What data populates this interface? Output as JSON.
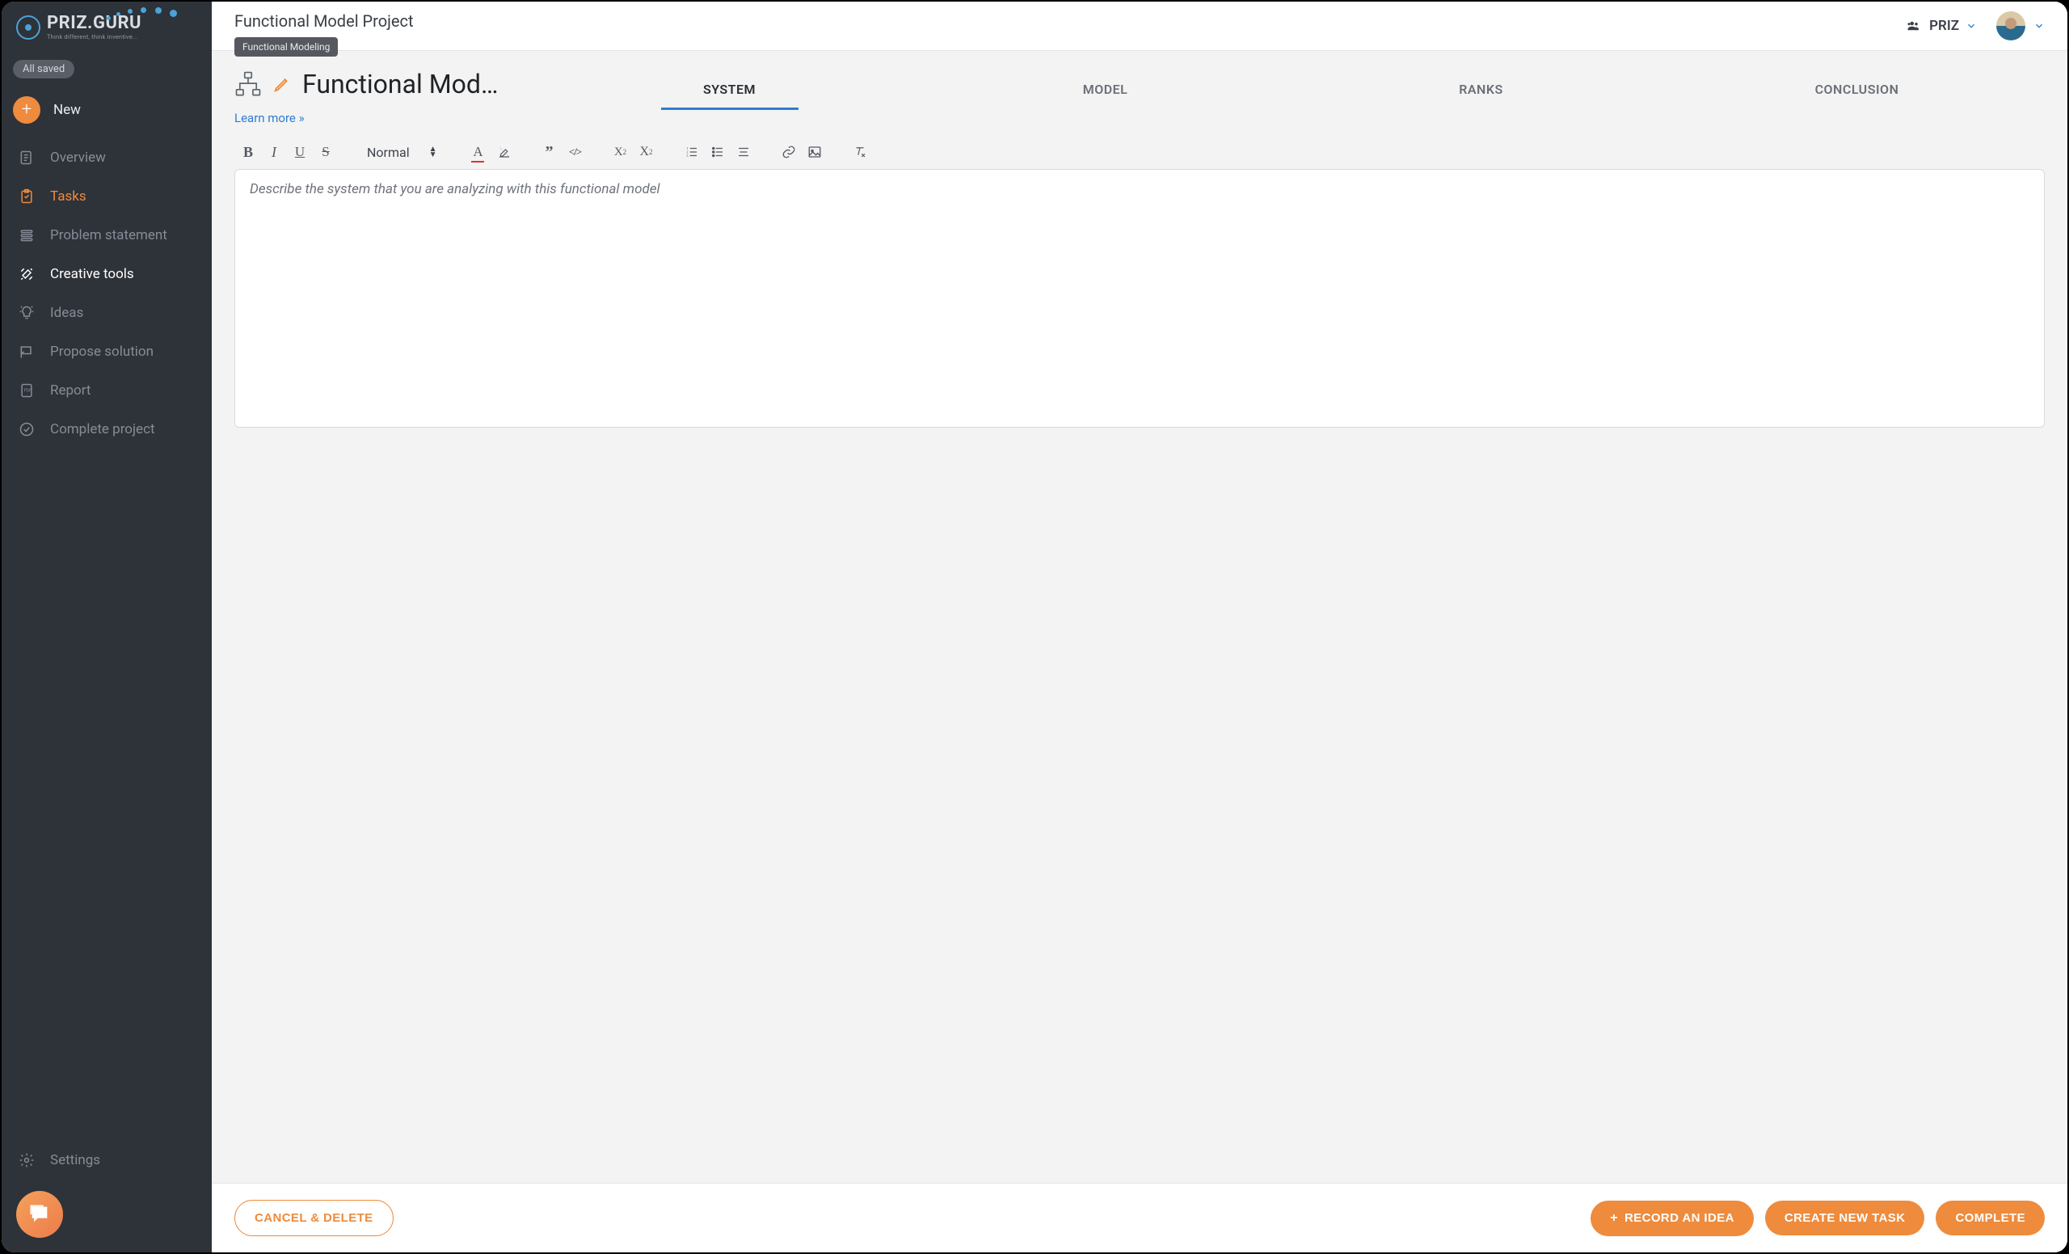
{
  "brand": {
    "name": "PRIZ.GURU",
    "tagline": "Think different, think inventive..."
  },
  "sidebar": {
    "saved_label": "All saved",
    "new_label": "New",
    "items": [
      {
        "label": "Overview"
      },
      {
        "label": "Tasks"
      },
      {
        "label": "Problem statement"
      },
      {
        "label": "Creative tools"
      },
      {
        "label": "Ideas"
      },
      {
        "label": "Propose solution"
      },
      {
        "label": "Report"
      },
      {
        "label": "Complete project"
      }
    ],
    "settings_label": "Settings"
  },
  "header": {
    "project_title": "Functional Model Project",
    "breadcrumb": "Functional Modeling",
    "workspace_label": "PRIZ"
  },
  "page": {
    "title": "Functional Mod…",
    "learn_more": "Learn more »"
  },
  "tabs": [
    {
      "label": "SYSTEM"
    },
    {
      "label": "MODEL"
    },
    {
      "label": "RANKS"
    },
    {
      "label": "CONCLUSION"
    }
  ],
  "editor": {
    "font_style_label": "Normal",
    "placeholder": "Describe the system that you are analyzing with this functional model"
  },
  "footer": {
    "cancel_label": "CANCEL & DELETE",
    "record_label": "RECORD AN IDEA",
    "create_label": "CREATE NEW TASK",
    "complete_label": "COMPLETE"
  },
  "colors": {
    "accent": "#ee8b3c",
    "link": "#2f7dd1",
    "sidebar_bg": "#2e3239"
  }
}
